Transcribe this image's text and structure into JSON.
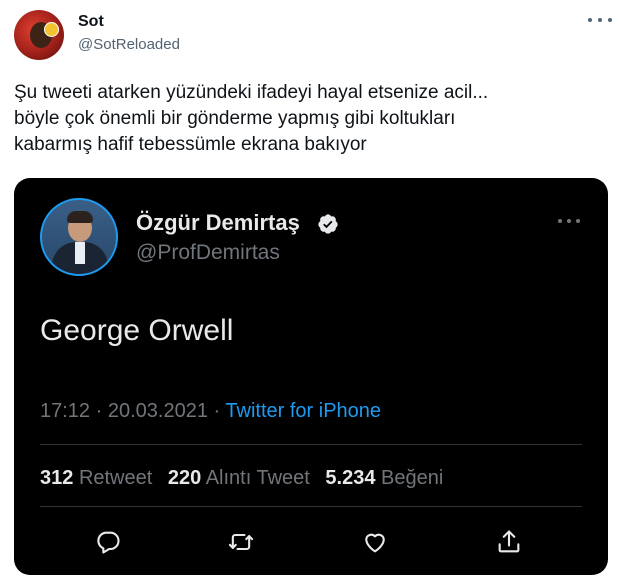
{
  "outer_tweet": {
    "name": "Sot",
    "handle": "@SotReloaded",
    "text_lines": [
      "Şu tweeti atarken yüzündeki ifadeyi hayal etsenize acil...",
      "böyle çok önemli bir gönderme yapmış gibi koltukları",
      "kabarmış hafif tebessümle ekrana bakıyor"
    ]
  },
  "quoted_tweet": {
    "name": "Özgür Demirtaş",
    "handle": "@ProfDemirtas",
    "verified": true,
    "text": "George Orwell",
    "time": "17:12",
    "separator": "·",
    "date": "20.03.2021",
    "source": "Twitter for iPhone",
    "stats": {
      "retweets_count": "312",
      "retweets_label": "Retweet",
      "quotes_count": "220",
      "quotes_label": "Alıntı Tweet",
      "likes_count": "5.234",
      "likes_label": "Beğeni"
    }
  },
  "icons": [
    "more-icon",
    "verified-badge-icon",
    "reply-icon",
    "retweet-icon",
    "like-icon",
    "share-icon"
  ],
  "colors": {
    "accent": "#1d9bf0",
    "dark_bg": "#000000",
    "muted": "#71767b"
  }
}
